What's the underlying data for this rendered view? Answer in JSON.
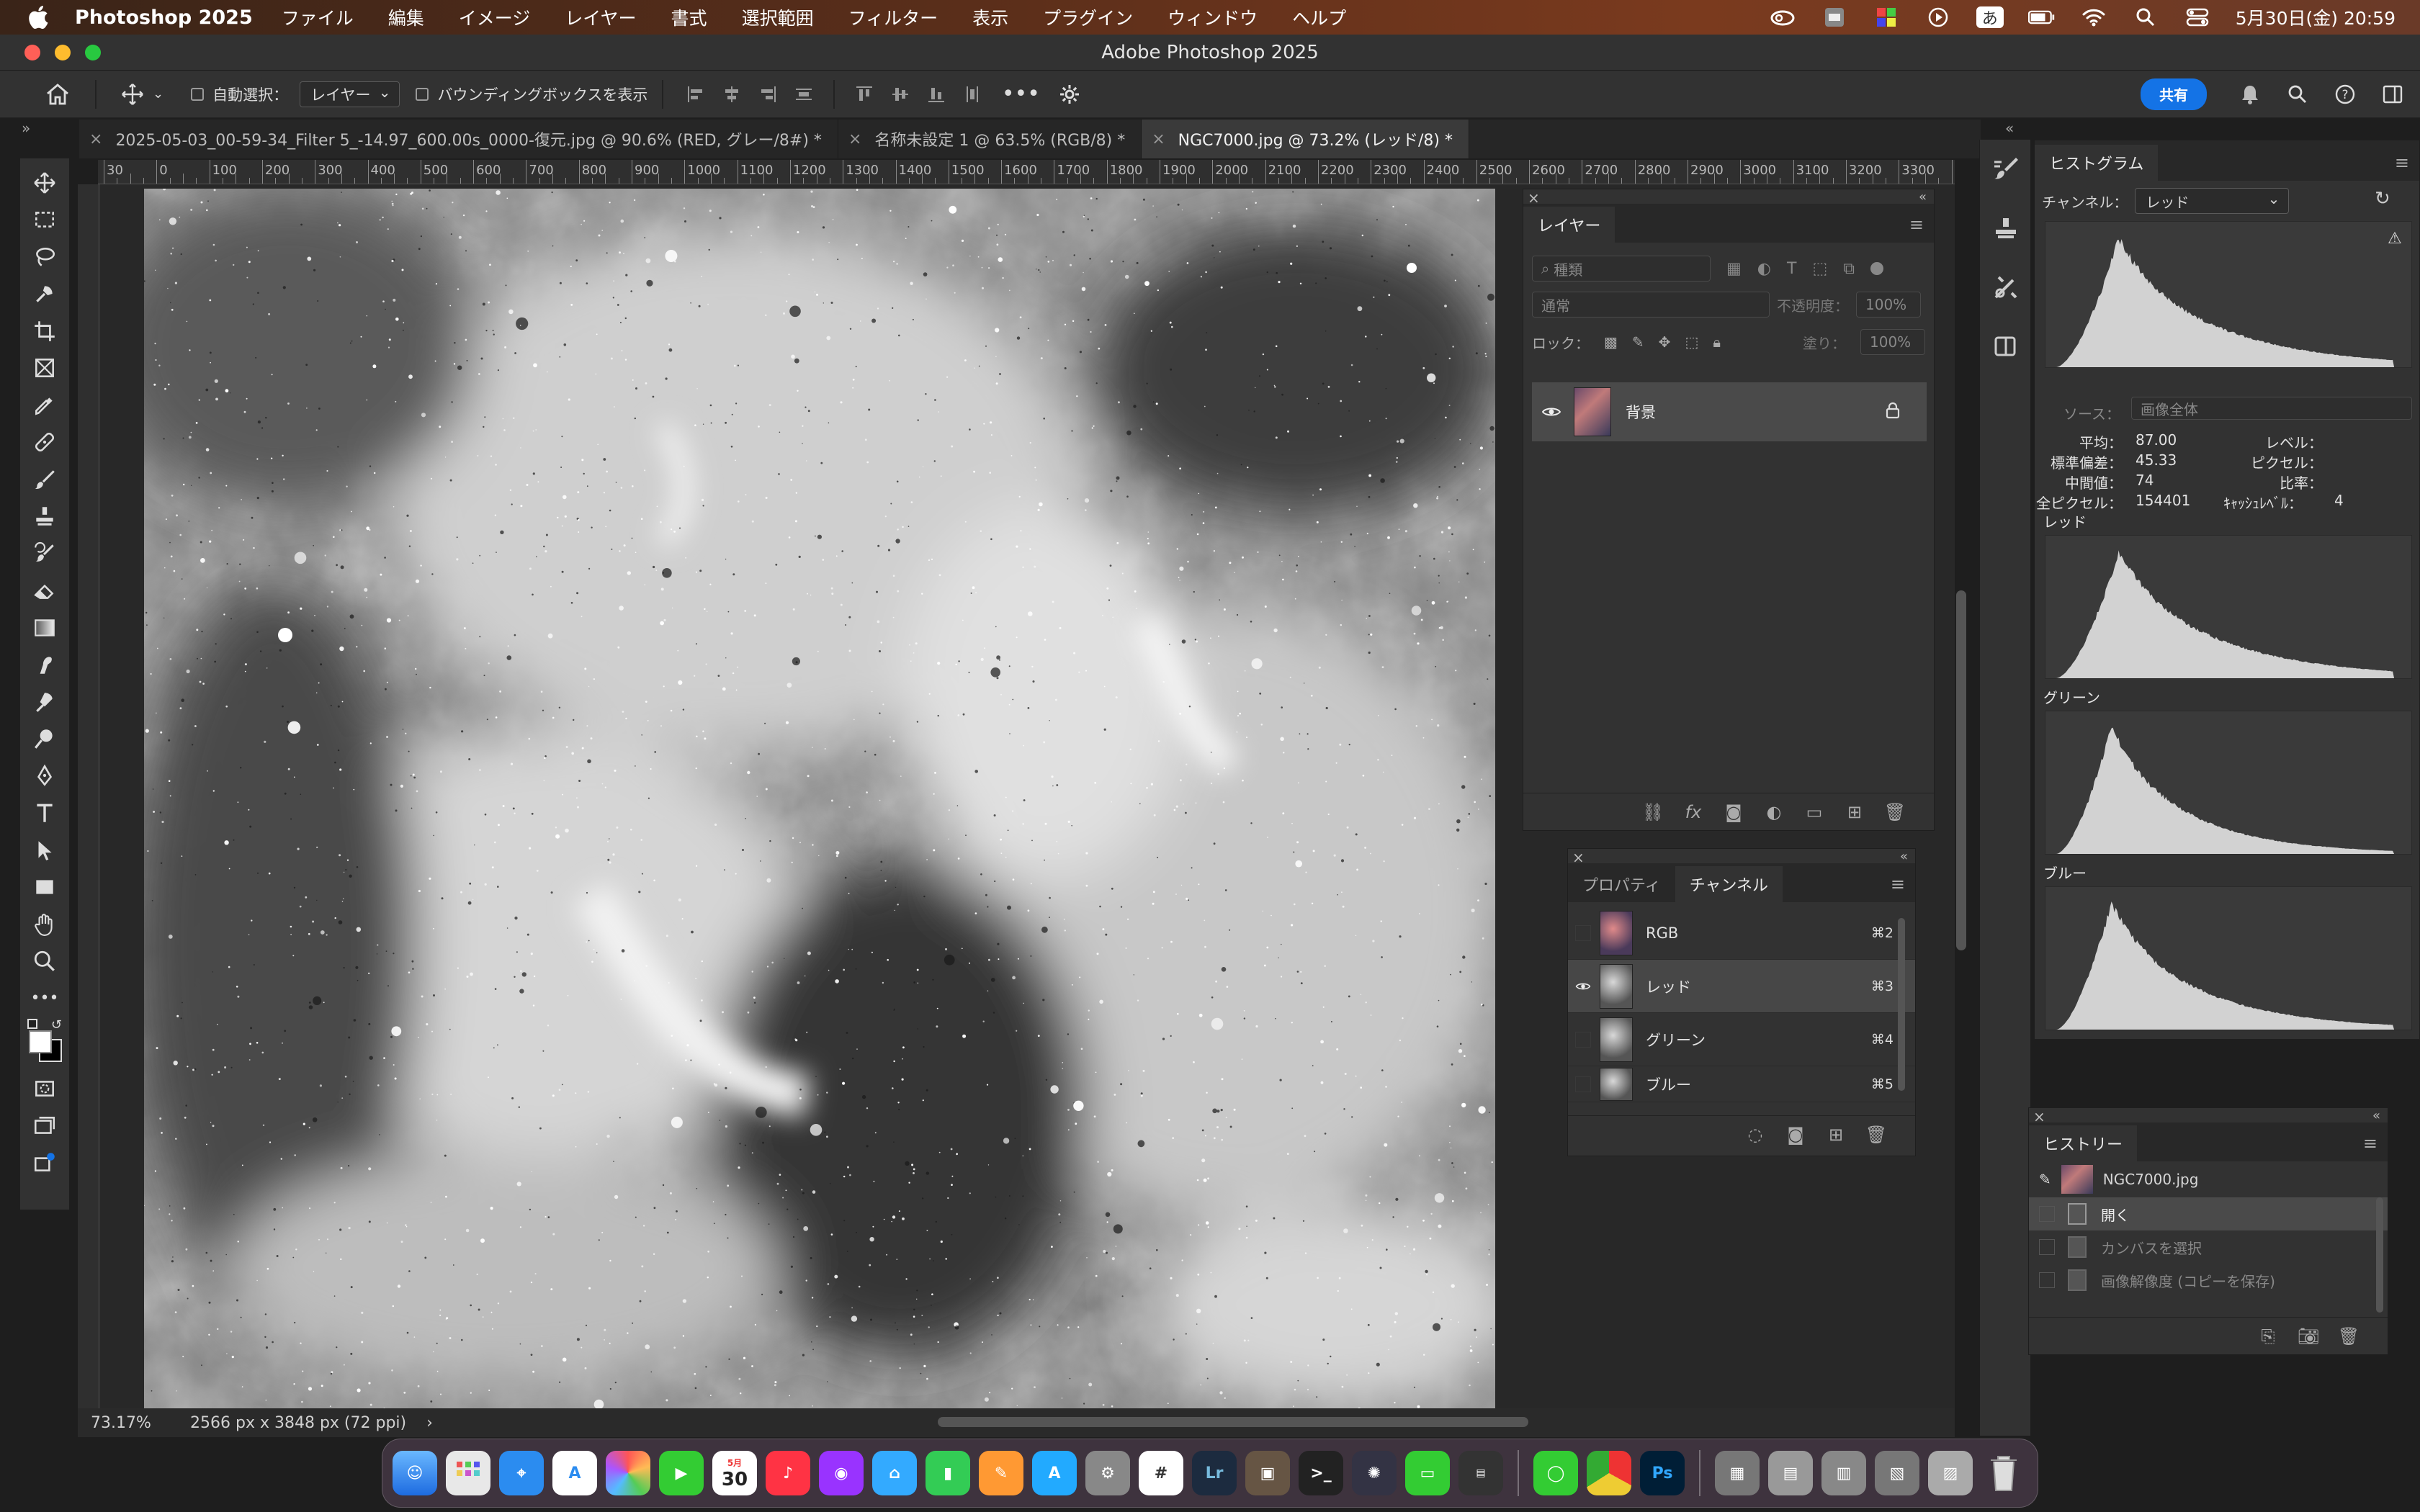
{
  "menubar": {
    "app": "Photoshop 2025",
    "menus": [
      "ファイル",
      "編集",
      "イメージ",
      "レイヤー",
      "書式",
      "選択範囲",
      "フィルター",
      "表示",
      "プラグイン",
      "ウィンドウ",
      "ヘルプ"
    ],
    "ime": "あ",
    "clock": "5月30日(金)  20:59"
  },
  "window": {
    "title": "Adobe Photoshop 2025"
  },
  "options": {
    "auto_select_label": "自動選択：",
    "auto_select_value": "レイヤー",
    "bounding_label": "バウンディングボックスを表示",
    "share_label": "共有"
  },
  "tabs": [
    {
      "label": "2025-05-03_00-59-34_Filter 5_-14.97_600.00s_0000-復元.jpg @ 90.6% (RED, グレー/8#) *"
    },
    {
      "label": "名称未設定 1 @ 63.5% (RGB/8) *"
    },
    {
      "label": "NGC7000.jpg @ 73.2% (レッド/8) *"
    }
  ],
  "ruler": {
    "labels": [
      "30",
      "0",
      "100",
      "200",
      "300",
      "400",
      "500",
      "600",
      "700",
      "800",
      "900",
      "1000",
      "1100",
      "1200",
      "1300",
      "1400",
      "1500",
      "1600",
      "1700",
      "1800",
      "1900",
      "2000",
      "2100",
      "2200",
      "2300",
      "2400",
      "2500",
      "2600",
      "2700",
      "2800",
      "2900",
      "3000",
      "3100",
      "3200",
      "3300",
      "34"
    ]
  },
  "status": {
    "zoom": "73.17%",
    "doc_info": "2566 px x 3848 px (72 ppi)",
    "arrow": "›"
  },
  "layers_panel": {
    "tab": "レイヤー",
    "filter_placeholder": "種類",
    "blend_mode": "通常",
    "opacity_label": "不透明度：",
    "opacity_value": "100%",
    "lock_label": "ロック：",
    "fill_label": "塗り：",
    "fill_value": "100%",
    "layer_name": "背景"
  },
  "channels_panel": {
    "tabs": [
      "プロパティ",
      "チャンネル"
    ],
    "rows": [
      {
        "name": "RGB",
        "key": "⌘2",
        "visible": false
      },
      {
        "name": "レッド",
        "key": "⌘3",
        "visible": true
      },
      {
        "name": "グリーン",
        "key": "⌘4",
        "visible": false
      },
      {
        "name": "ブルー",
        "key": "⌘5",
        "visible": false
      }
    ]
  },
  "histogram_panel": {
    "tab": "ヒストグラム",
    "channel_label": "チャンネル：",
    "channel_value": "レッド",
    "source_label": "ソース：",
    "source_value": "画像全体",
    "stats": {
      "mean_label": "平均：",
      "mean": "87.00",
      "stddev_label": "標準偏差：",
      "stddev": "45.33",
      "median_label": "中間値：",
      "median": "74",
      "pixels_label": "全ピクセル：",
      "pixels": "154401",
      "level_label": "レベル：",
      "count_label": "ピクセル：",
      "percentile_label": "比率：",
      "cache_label": "ｷｬｯｼｭﾚﾍﾞﾙ：",
      "cache": "4"
    },
    "red_label": "レッド",
    "green_label": "グリーン",
    "blue_label": "ブルー"
  },
  "history_panel": {
    "tab": "ヒストリー",
    "snapshot": "NGC7000.jpg",
    "items": [
      "開く",
      "カンバスを選択",
      "画像解像度 (コピーを保存)"
    ]
  },
  "dock": {
    "calendar_day": "30",
    "calendar_month": "5月",
    "lr": "Lr",
    "ps": "Ps"
  },
  "colors": {
    "accent": "#1473e6",
    "panel": "#323232",
    "panel_dark": "#282828",
    "selection": "#474747"
  }
}
